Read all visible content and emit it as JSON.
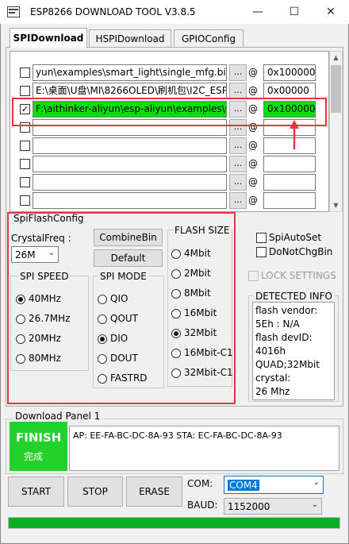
{
  "window": {
    "title": "ESP8266 DOWNLOAD TOOL V3.8.5",
    "minimize_glyph": "—",
    "maximize_glyph": "☐",
    "close_glyph": "✕"
  },
  "tabs": [
    {
      "label": "SPIDownload",
      "active": true
    },
    {
      "label": "HSPIDownload",
      "active": false
    },
    {
      "label": "GPIOConfig",
      "active": false
    }
  ],
  "file_rows": [
    {
      "checked": false,
      "path": "yun\\examples\\smart_light\\single_mfg.bin",
      "browse": "...",
      "at": "@",
      "address": "0x100000"
    },
    {
      "checked": false,
      "path": "E:\\桌面\\U盘\\MI\\8266OLED\\刷机包\\I2C_ESP",
      "browse": "...",
      "at": "@",
      "address": "0x00000"
    },
    {
      "checked": true,
      "path": "F:\\aithinker-aliyun\\esp-aliyun\\examples\\smart",
      "browse": "...",
      "at": "@",
      "address": "0x100000"
    },
    {
      "checked": false,
      "path": "",
      "browse": "...",
      "at": "@",
      "address": ""
    },
    {
      "checked": false,
      "path": "",
      "browse": "...",
      "at": "@",
      "address": ""
    },
    {
      "checked": false,
      "path": "",
      "browse": "...",
      "at": "@",
      "address": ""
    },
    {
      "checked": false,
      "path": "",
      "browse": "...",
      "at": "@",
      "address": ""
    },
    {
      "checked": false,
      "path": "",
      "browse": "...",
      "at": "@",
      "address": ""
    }
  ],
  "colors": {
    "highlight_green": "#00e000",
    "annotation_red": "#e5363b",
    "finish_green": "#22d12a",
    "progress_green": "#06b025"
  },
  "spi_flash_config": {
    "title": "SpiFlashConfig",
    "crystal_freq_label": "CrystalFreq :",
    "crystal_freq_value": "26M",
    "combine_bin_label": "CombineBin",
    "default_label": "Default",
    "spi_speed": {
      "title": "SPI SPEED",
      "options": [
        {
          "label": "40MHz",
          "selected": true
        },
        {
          "label": "26.7MHz",
          "selected": false
        },
        {
          "label": "20MHz",
          "selected": false
        },
        {
          "label": "80MHz",
          "selected": false
        }
      ]
    },
    "spi_mode": {
      "title": "SPI MODE",
      "options": [
        {
          "label": "QIO",
          "selected": false
        },
        {
          "label": "QOUT",
          "selected": false
        },
        {
          "label": "DIO",
          "selected": true
        },
        {
          "label": "DOUT",
          "selected": false
        },
        {
          "label": "FASTRD",
          "selected": false
        }
      ]
    },
    "flash_size": {
      "title": "FLASH SIZE",
      "options": [
        {
          "label": "4Mbit",
          "selected": false
        },
        {
          "label": "2Mbit",
          "selected": false
        },
        {
          "label": "8Mbit",
          "selected": false
        },
        {
          "label": "16Mbit",
          "selected": false
        },
        {
          "label": "32Mbit",
          "selected": true
        },
        {
          "label": "16Mbit-C1",
          "selected": false
        },
        {
          "label": "32Mbit-C1",
          "selected": false
        }
      ]
    }
  },
  "right_panel": {
    "spi_auto_set": "SpiAutoSet",
    "do_not_chg_bin": "DoNotChgBin",
    "lock_settings": "LOCK SETTINGS",
    "detected_info_title": "DETECTED INFO",
    "detected_info_lines": [
      "flash vendor:",
      "5Eh : N/A",
      "flash devID:",
      "4016h",
      "QUAD;32Mbit",
      "crystal:",
      "26 Mhz"
    ]
  },
  "download_panel": {
    "title": "Download Panel 1",
    "status_text": "FINISH",
    "status_subtext": "完成",
    "log_text": "AP:  EE-FA-BC-DC-8A-93   STA:  EC-FA-BC-DC-8A-93"
  },
  "controls": {
    "start_label": "START",
    "stop_label": "STOP",
    "erase_label": "ERASE",
    "com_label": "COM:",
    "com_value": "COM4",
    "baud_label": "BAUD:",
    "baud_value": "1152000"
  },
  "progress_fraction": 1.0
}
